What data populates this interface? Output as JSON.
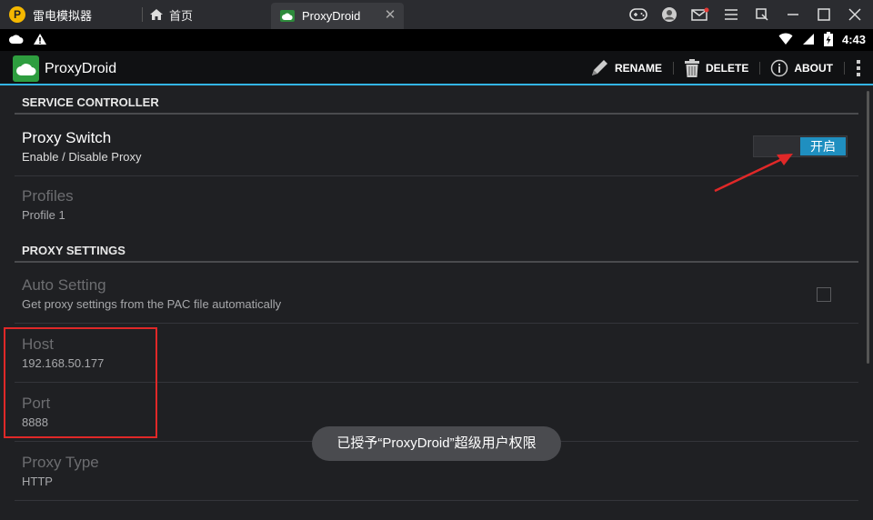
{
  "emulator": {
    "brand": "雷电模拟器",
    "home_tab": "首页",
    "app_tab": "ProxyDroid"
  },
  "status_bar": {
    "time": "4:43"
  },
  "action_bar": {
    "title": "ProxyDroid",
    "actions": {
      "rename": "RENAME",
      "delete": "DELETE",
      "about": "ABOUT"
    }
  },
  "sections": {
    "service_controller": "SERVICE CONTROLLER",
    "proxy_settings": "PROXY SETTINGS"
  },
  "prefs": {
    "proxy_switch": {
      "title": "Proxy Switch",
      "summary": "Enable / Disable Proxy",
      "toggle_label": "开启"
    },
    "profiles": {
      "title": "Profiles",
      "summary": "Profile 1"
    },
    "auto_setting": {
      "title": "Auto Setting",
      "summary": "Get proxy settings from the PAC file automatically"
    },
    "host": {
      "title": "Host",
      "summary": "192.168.50.177"
    },
    "port": {
      "title": "Port",
      "summary": "8888"
    },
    "proxy_type": {
      "title": "Proxy Type",
      "summary": "HTTP"
    }
  },
  "toast": "已授予“ProxyDroid”超级用户权限",
  "colors": {
    "accent": "#33b5e5",
    "toggle_on": "#1f8fc0",
    "annotation": "#e02828",
    "app_icon": "#2e9d3f"
  }
}
